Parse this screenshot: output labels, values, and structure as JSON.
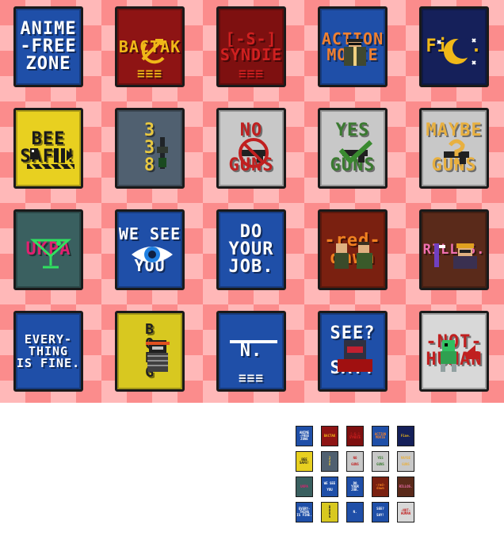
{
  "sheet": {
    "checker_light": "#ffb8b8",
    "checker_dark": "#fb8c8c",
    "posters": [
      {
        "id": "anime-free-zone",
        "text": "ANIME\n-FREE\nZONE",
        "bg": "#1f4fa8",
        "fg": "#ffffff",
        "icon": "none"
      },
      {
        "id": "vaktik",
        "text": "BACTAK",
        "sub": "≡≡≡",
        "bg": "#8e1414",
        "fg": "#f0b818",
        "icon": "hammer-sickle-icon"
      },
      {
        "id": "syndie",
        "text": "[-S-]\nSYNDIE",
        "sub": "≡≡≡",
        "bg": "#7e1010",
        "fg": "#d02020",
        "icon": "none"
      },
      {
        "id": "action-movie",
        "text": "ACTION\nMOVIE",
        "bg": "#1f4fa8",
        "fg": "#f08030",
        "icon": "action-hero-icon"
      },
      {
        "id": "fine",
        "text": "Fine.",
        "bg": "#15205a",
        "fg": "#f0b818",
        "icon": "crescent-moon-icon"
      },
      {
        "id": "bee-safe",
        "text": "BEE\nSAFE!",
        "bg": "#e8d020",
        "fg": "#1a1a1a",
        "icon": "bee-icon"
      },
      {
        "id": "ssb",
        "text": "3\n3\n8",
        "bg": "#506070",
        "fg": "#e8c840",
        "icon": "rifle-icon"
      },
      {
        "id": "no-guns",
        "text": "NO\n\nGUNS",
        "bg": "#c8c8c8",
        "fg": "#c02020",
        "icon": "no-gun-icon"
      },
      {
        "id": "yes-guns",
        "text": "YES\n\nGUNS",
        "bg": "#c8c8c8",
        "fg": "#3a7a30",
        "icon": "check-gun-icon"
      },
      {
        "id": "maybe-guns",
        "text": "MAYBE\n\nGUNS",
        "bg": "#c8c8c8",
        "fg": "#e8b040",
        "icon": "question-gun-icon"
      },
      {
        "id": "ukpa",
        "text": "UKPA",
        "bg": "#3a6060",
        "fg": "#e02070",
        "icon": "cocktail-glass-icon"
      },
      {
        "id": "we-see-you",
        "text": "WE SEE\n\nYOU",
        "bg": "#1f4fa8",
        "fg": "#ffffff",
        "icon": "eye-icon"
      },
      {
        "id": "do-your-job",
        "text": "DO\nYOUR\nJOB.",
        "bg": "#1f4fa8",
        "fg": "#ffffff",
        "icon": "none"
      },
      {
        "id": "red-dawn",
        "text": "-red-\ndawn",
        "bg": "#7a2010",
        "fg": "#f08020",
        "icon": "soldiers-icon"
      },
      {
        "id": "rillos",
        "text": "RILLOS.",
        "bg": "#5a2a1a",
        "fg": "#f070b0",
        "icon": "smoker-icon"
      },
      {
        "id": "everything-is-fine",
        "text": "EVERY-\nTHING\nIS FINE.",
        "bg": "#1f4fa8",
        "fg": "#ffffff",
        "icon": "none"
      },
      {
        "id": "borg",
        "text": "B\nO\nR\nG",
        "bg": "#d8c820",
        "fg": "#202020",
        "icon": "borg-robot-icon"
      },
      {
        "id": "nt-logo",
        "text": "N.",
        "sub": "≡≡≡",
        "bg": "#1f4fa8",
        "fg": "#ffffff",
        "icon": "nanotrasen-logo-icon"
      },
      {
        "id": "see-say",
        "text": "SEE?\n\nSAY!",
        "bg": "#1f4fa8",
        "fg": "#ffffff",
        "icon": "red-helmet-icon"
      },
      {
        "id": "not-human",
        "text": "-NOT-\nHUMAN",
        "bg": "#d8d8d8",
        "fg": "#c02020",
        "icon": "green-alien-icon"
      }
    ]
  }
}
